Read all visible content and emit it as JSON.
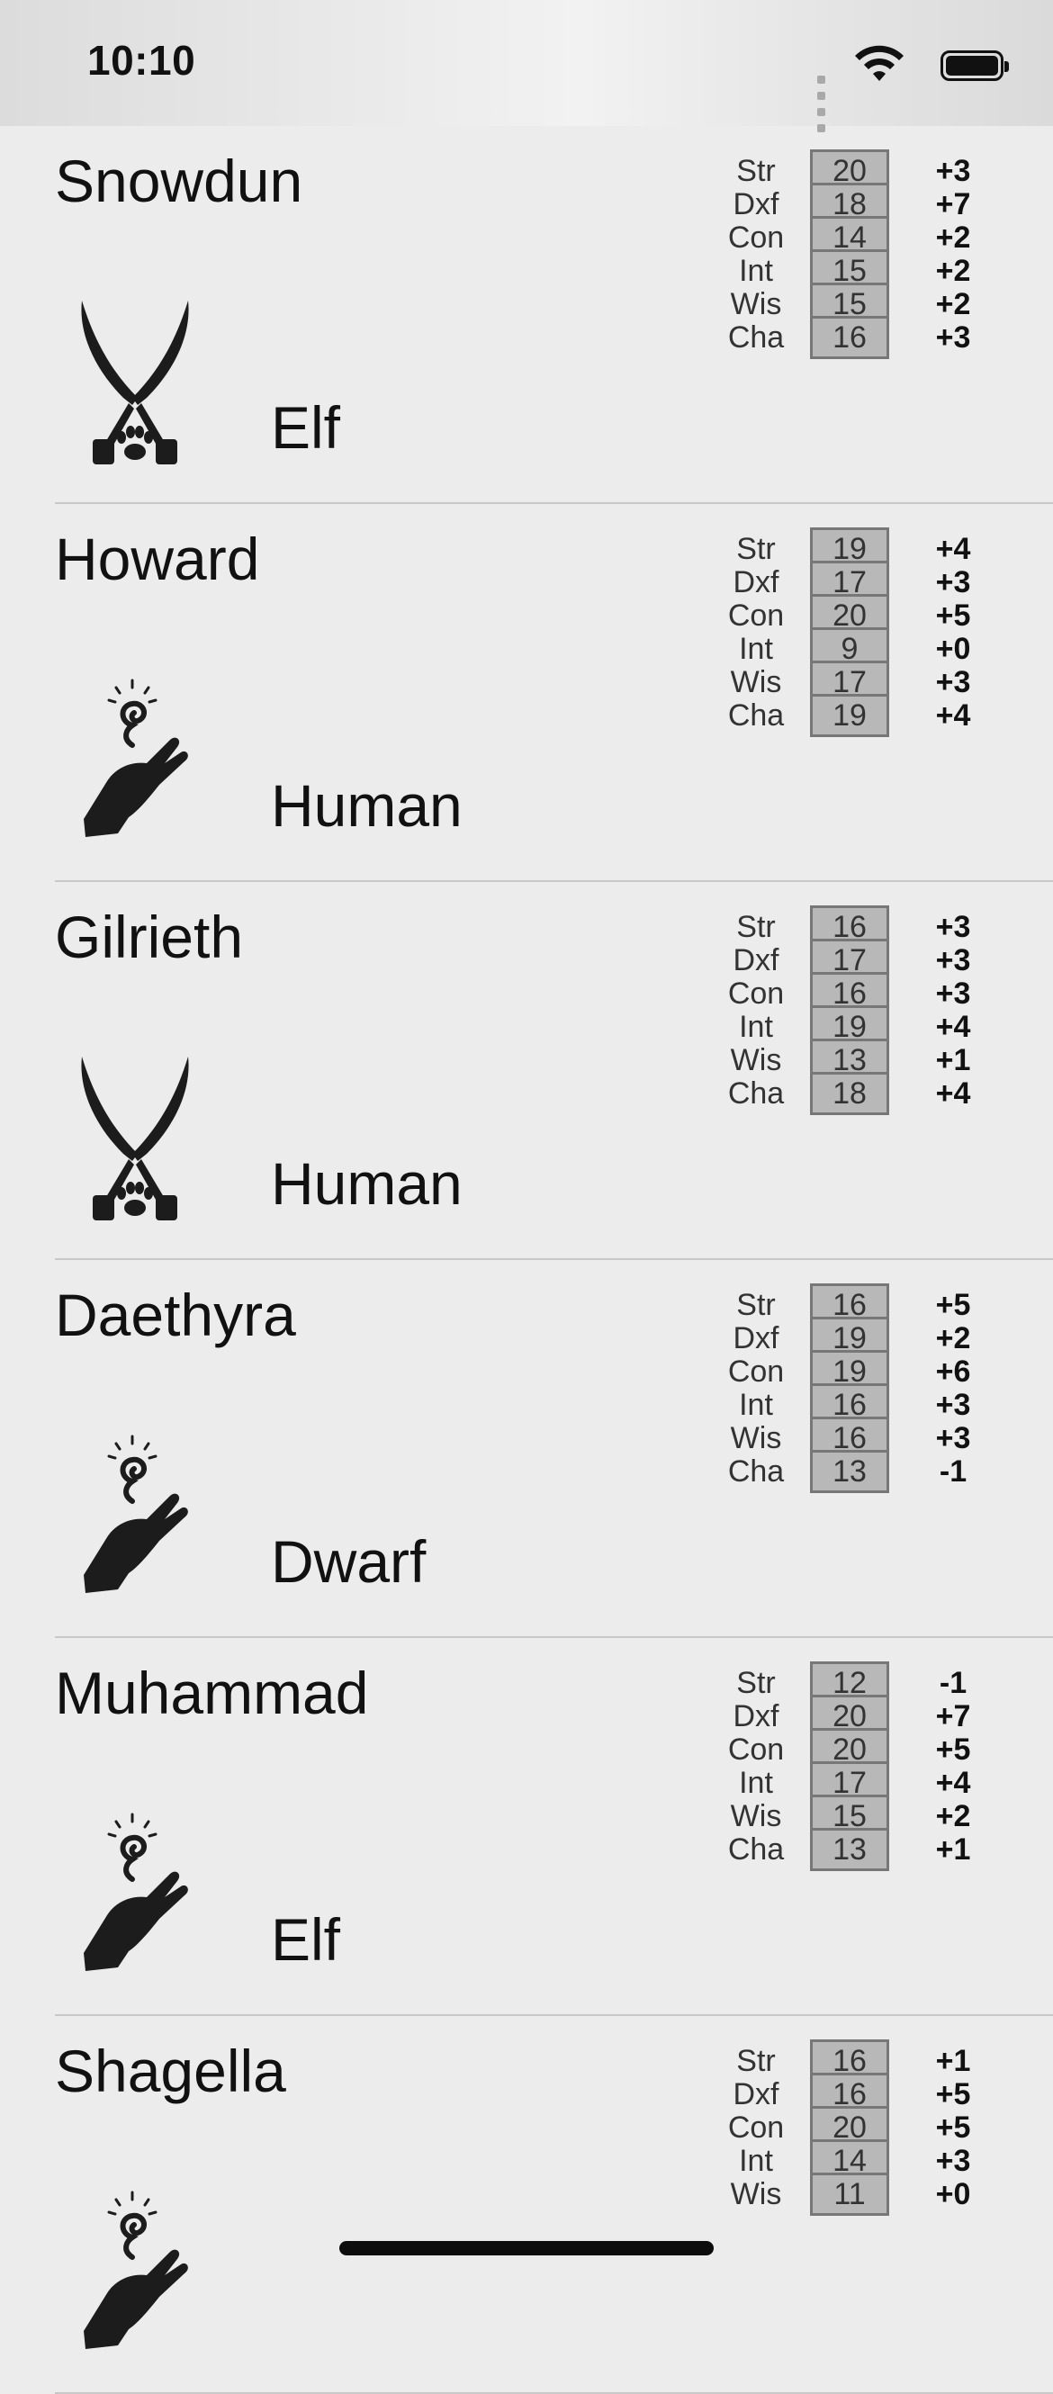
{
  "status_bar": {
    "time": "10:10"
  },
  "characters": [
    {
      "name": "Snowdun",
      "race": "Elf",
      "icon": "crossed-scimitars-paw-icon",
      "stats": [
        {
          "label": "Str",
          "value": "20",
          "mod": "+3"
        },
        {
          "label": "Dxf",
          "value": "18",
          "mod": "+7"
        },
        {
          "label": "Con",
          "value": "14",
          "mod": "+2"
        },
        {
          "label": "Int",
          "value": "15",
          "mod": "+2"
        },
        {
          "label": "Wis",
          "value": "15",
          "mod": "+2"
        },
        {
          "label": "Cha",
          "value": "16",
          "mod": "+3"
        }
      ]
    },
    {
      "name": "Howard",
      "race": "Human",
      "icon": "spellcasting-hand-icon",
      "stats": [
        {
          "label": "Str",
          "value": "19",
          "mod": "+4"
        },
        {
          "label": "Dxf",
          "value": "17",
          "mod": "+3"
        },
        {
          "label": "Con",
          "value": "20",
          "mod": "+5"
        },
        {
          "label": "Int",
          "value": "9",
          "mod": "+0"
        },
        {
          "label": "Wis",
          "value": "17",
          "mod": "+3"
        },
        {
          "label": "Cha",
          "value": "19",
          "mod": "+4"
        }
      ]
    },
    {
      "name": "Gilrieth",
      "race": "Human",
      "icon": "crossed-scimitars-paw-icon",
      "stats": [
        {
          "label": "Str",
          "value": "16",
          "mod": "+3"
        },
        {
          "label": "Dxf",
          "value": "17",
          "mod": "+3"
        },
        {
          "label": "Con",
          "value": "16",
          "mod": "+3"
        },
        {
          "label": "Int",
          "value": "19",
          "mod": "+4"
        },
        {
          "label": "Wis",
          "value": "13",
          "mod": "+1"
        },
        {
          "label": "Cha",
          "value": "18",
          "mod": "+4"
        }
      ]
    },
    {
      "name": "Daethyra",
      "race": "Dwarf",
      "icon": "spellcasting-hand-icon",
      "stats": [
        {
          "label": "Str",
          "value": "16",
          "mod": "+5"
        },
        {
          "label": "Dxf",
          "value": "19",
          "mod": "+2"
        },
        {
          "label": "Con",
          "value": "19",
          "mod": "+6"
        },
        {
          "label": "Int",
          "value": "16",
          "mod": "+3"
        },
        {
          "label": "Wis",
          "value": "16",
          "mod": "+3"
        },
        {
          "label": "Cha",
          "value": "13",
          "mod": "-1"
        }
      ]
    },
    {
      "name": "Muhammad",
      "race": "Elf",
      "icon": "spellcasting-hand-icon",
      "stats": [
        {
          "label": "Str",
          "value": "12",
          "mod": "-1"
        },
        {
          "label": "Dxf",
          "value": "20",
          "mod": "+7"
        },
        {
          "label": "Con",
          "value": "20",
          "mod": "+5"
        },
        {
          "label": "Int",
          "value": "17",
          "mod": "+4"
        },
        {
          "label": "Wis",
          "value": "15",
          "mod": "+2"
        },
        {
          "label": "Cha",
          "value": "13",
          "mod": "+1"
        }
      ]
    },
    {
      "name": "Shagella",
      "race": "",
      "icon": "spellcasting-hand-icon",
      "stats": [
        {
          "label": "Str",
          "value": "16",
          "mod": "+1"
        },
        {
          "label": "Dxf",
          "value": "16",
          "mod": "+5"
        },
        {
          "label": "Con",
          "value": "20",
          "mod": "+5"
        },
        {
          "label": "Int",
          "value": "14",
          "mod": "+3"
        },
        {
          "label": "Wis",
          "value": "11",
          "mod": "+0"
        }
      ]
    }
  ]
}
